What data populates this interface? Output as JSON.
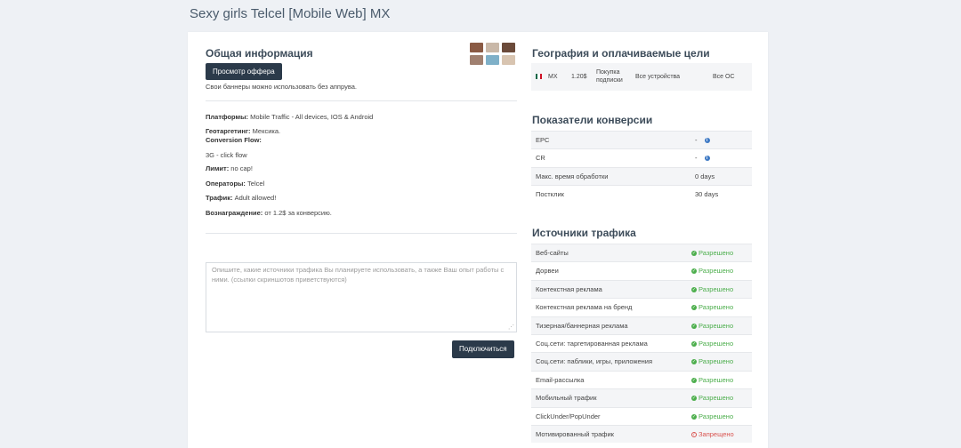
{
  "page": {
    "title": "Sexy girls Telcel [Mobile Web] MX"
  },
  "general": {
    "heading": "Общая информация",
    "view_offer_label": "Просмотр оффера",
    "banner_note": "Свои баннеры можно использовать без аппрува.",
    "platforms_label": "Платформы:",
    "platforms_value": "Mobile Traffic - All devices, IOS & Android",
    "geo_label": "Геотаргетинг:",
    "geo_value": "Мексика.",
    "flow_label": "Conversion Flow:",
    "flow_value": "3G - click flow",
    "limit_label": "Лимит:",
    "limit_value": "no cap!",
    "operators_label": "Операторы:",
    "operators_value": "Telcel",
    "traffic_label": "Трафик:",
    "traffic_value": "Adult allowed!",
    "reward_label": "Вознаграждение:",
    "reward_value": "от 1.2$ за конверсию."
  },
  "form": {
    "textarea_placeholder": "Опишите, какие источники трафика Вы планируете использовать, а также Ваш опыт работы с ними. (ссылки скриншотов приветствуются)",
    "connect_label": "Подключиться"
  },
  "geography": {
    "heading": "География и оплачиваемые цели",
    "country": "MX",
    "payout": "1.20$",
    "goal": "Покупка подписки",
    "devices": "Все устройства",
    "os": "Все ОС",
    "flag_colors": [
      "#006847",
      "#ffffff",
      "#ce1126"
    ]
  },
  "conversion": {
    "heading": "Показатели конверсии",
    "rows": [
      {
        "label": "EPC",
        "value": "-",
        "info": true
      },
      {
        "label": "CR",
        "value": "-",
        "info": true
      },
      {
        "label": "Макс. время обработки",
        "value": "0 days",
        "info": false
      },
      {
        "label": "Постклик",
        "value": "30 days",
        "info": false
      }
    ]
  },
  "sources": {
    "heading": "Источники трафика",
    "allowed_text": "Разрешено",
    "denied_text": "Запрещено",
    "rows": [
      {
        "label": "Веб-сайты",
        "allowed": true
      },
      {
        "label": "Дорвеи",
        "allowed": true
      },
      {
        "label": "Контекстная реклама",
        "allowed": true
      },
      {
        "label": "Контекстная реклама на бренд",
        "allowed": true
      },
      {
        "label": "Тизерная/баннерная реклама",
        "allowed": true
      },
      {
        "label": "Соц.сети: таргетированная реклама",
        "allowed": true
      },
      {
        "label": "Соц.сети: паблики, игры, приложения",
        "allowed": true
      },
      {
        "label": "Email-рассылка",
        "allowed": true
      },
      {
        "label": "Мобильный трафик",
        "allowed": true
      },
      {
        "label": "ClickUnder/PopUnder",
        "allowed": true
      },
      {
        "label": "Мотивированный трафик",
        "allowed": false
      }
    ]
  },
  "colors": {
    "accent": "#2b3a4a",
    "allowed": "#4cae4c",
    "denied": "#d9534f"
  }
}
